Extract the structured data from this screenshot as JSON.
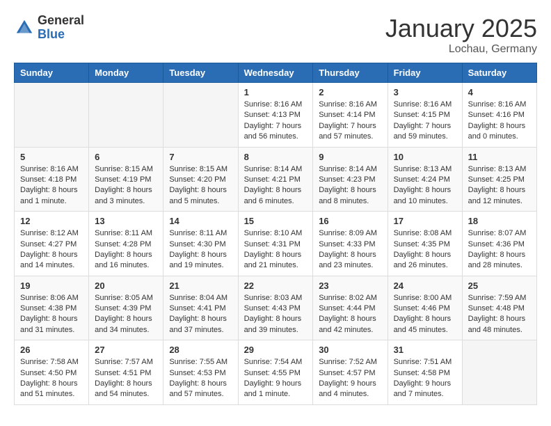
{
  "header": {
    "logo_general": "General",
    "logo_blue": "Blue",
    "month_year": "January 2025",
    "location": "Lochau, Germany"
  },
  "days_of_week": [
    "Sunday",
    "Monday",
    "Tuesday",
    "Wednesday",
    "Thursday",
    "Friday",
    "Saturday"
  ],
  "weeks": [
    [
      {
        "day": "",
        "sunrise": "",
        "sunset": "",
        "daylight": ""
      },
      {
        "day": "",
        "sunrise": "",
        "sunset": "",
        "daylight": ""
      },
      {
        "day": "",
        "sunrise": "",
        "sunset": "",
        "daylight": ""
      },
      {
        "day": "1",
        "sunrise": "8:16 AM",
        "sunset": "4:13 PM",
        "daylight": "7 hours and 56 minutes."
      },
      {
        "day": "2",
        "sunrise": "8:16 AM",
        "sunset": "4:14 PM",
        "daylight": "7 hours and 57 minutes."
      },
      {
        "day": "3",
        "sunrise": "8:16 AM",
        "sunset": "4:15 PM",
        "daylight": "7 hours and 59 minutes."
      },
      {
        "day": "4",
        "sunrise": "8:16 AM",
        "sunset": "4:16 PM",
        "daylight": "8 hours and 0 minutes."
      }
    ],
    [
      {
        "day": "5",
        "sunrise": "8:16 AM",
        "sunset": "4:18 PM",
        "daylight": "8 hours and 1 minute."
      },
      {
        "day": "6",
        "sunrise": "8:15 AM",
        "sunset": "4:19 PM",
        "daylight": "8 hours and 3 minutes."
      },
      {
        "day": "7",
        "sunrise": "8:15 AM",
        "sunset": "4:20 PM",
        "daylight": "8 hours and 5 minutes."
      },
      {
        "day": "8",
        "sunrise": "8:14 AM",
        "sunset": "4:21 PM",
        "daylight": "8 hours and 6 minutes."
      },
      {
        "day": "9",
        "sunrise": "8:14 AM",
        "sunset": "4:23 PM",
        "daylight": "8 hours and 8 minutes."
      },
      {
        "day": "10",
        "sunrise": "8:13 AM",
        "sunset": "4:24 PM",
        "daylight": "8 hours and 10 minutes."
      },
      {
        "day": "11",
        "sunrise": "8:13 AM",
        "sunset": "4:25 PM",
        "daylight": "8 hours and 12 minutes."
      }
    ],
    [
      {
        "day": "12",
        "sunrise": "8:12 AM",
        "sunset": "4:27 PM",
        "daylight": "8 hours and 14 minutes."
      },
      {
        "day": "13",
        "sunrise": "8:11 AM",
        "sunset": "4:28 PM",
        "daylight": "8 hours and 16 minutes."
      },
      {
        "day": "14",
        "sunrise": "8:11 AM",
        "sunset": "4:30 PM",
        "daylight": "8 hours and 19 minutes."
      },
      {
        "day": "15",
        "sunrise": "8:10 AM",
        "sunset": "4:31 PM",
        "daylight": "8 hours and 21 minutes."
      },
      {
        "day": "16",
        "sunrise": "8:09 AM",
        "sunset": "4:33 PM",
        "daylight": "8 hours and 23 minutes."
      },
      {
        "day": "17",
        "sunrise": "8:08 AM",
        "sunset": "4:35 PM",
        "daylight": "8 hours and 26 minutes."
      },
      {
        "day": "18",
        "sunrise": "8:07 AM",
        "sunset": "4:36 PM",
        "daylight": "8 hours and 28 minutes."
      }
    ],
    [
      {
        "day": "19",
        "sunrise": "8:06 AM",
        "sunset": "4:38 PM",
        "daylight": "8 hours and 31 minutes."
      },
      {
        "day": "20",
        "sunrise": "8:05 AM",
        "sunset": "4:39 PM",
        "daylight": "8 hours and 34 minutes."
      },
      {
        "day": "21",
        "sunrise": "8:04 AM",
        "sunset": "4:41 PM",
        "daylight": "8 hours and 37 minutes."
      },
      {
        "day": "22",
        "sunrise": "8:03 AM",
        "sunset": "4:43 PM",
        "daylight": "8 hours and 39 minutes."
      },
      {
        "day": "23",
        "sunrise": "8:02 AM",
        "sunset": "4:44 PM",
        "daylight": "8 hours and 42 minutes."
      },
      {
        "day": "24",
        "sunrise": "8:00 AM",
        "sunset": "4:46 PM",
        "daylight": "8 hours and 45 minutes."
      },
      {
        "day": "25",
        "sunrise": "7:59 AM",
        "sunset": "4:48 PM",
        "daylight": "8 hours and 48 minutes."
      }
    ],
    [
      {
        "day": "26",
        "sunrise": "7:58 AM",
        "sunset": "4:50 PM",
        "daylight": "8 hours and 51 minutes."
      },
      {
        "day": "27",
        "sunrise": "7:57 AM",
        "sunset": "4:51 PM",
        "daylight": "8 hours and 54 minutes."
      },
      {
        "day": "28",
        "sunrise": "7:55 AM",
        "sunset": "4:53 PM",
        "daylight": "8 hours and 57 minutes."
      },
      {
        "day": "29",
        "sunrise": "7:54 AM",
        "sunset": "4:55 PM",
        "daylight": "9 hours and 1 minute."
      },
      {
        "day": "30",
        "sunrise": "7:52 AM",
        "sunset": "4:57 PM",
        "daylight": "9 hours and 4 minutes."
      },
      {
        "day": "31",
        "sunrise": "7:51 AM",
        "sunset": "4:58 PM",
        "daylight": "9 hours and 7 minutes."
      },
      {
        "day": "",
        "sunrise": "",
        "sunset": "",
        "daylight": ""
      }
    ]
  ]
}
